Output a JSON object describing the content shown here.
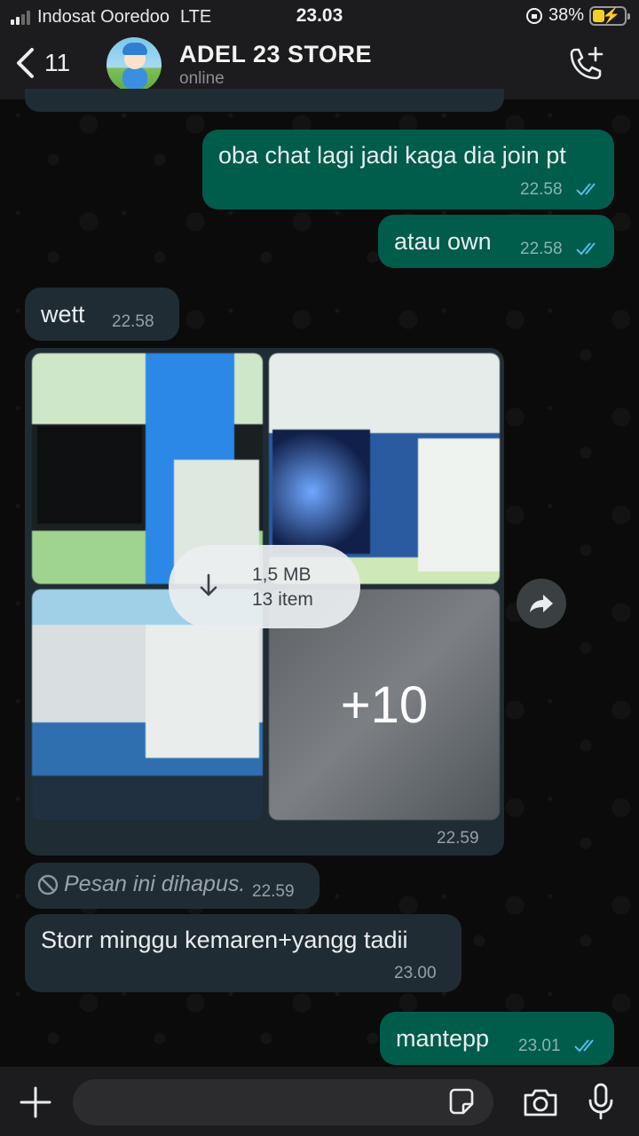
{
  "status_bar": {
    "carrier": "Indosat Ooredoo",
    "network": "LTE",
    "time": "23.03",
    "battery": "38%",
    "battery_level": 0.38
  },
  "header": {
    "back_count": "11",
    "contact_name": "ADEL 23 STORE",
    "contact_status": "online"
  },
  "messages": [
    {
      "direction": "out",
      "text": "oba chat lagi jadi kaga dia join pt",
      "time": "22.58",
      "read": true
    },
    {
      "direction": "out",
      "text": "atau own",
      "time": "22.58",
      "read": true
    },
    {
      "direction": "in",
      "text": "wett",
      "time": "22.58"
    },
    {
      "direction": "in",
      "type": "album",
      "size": "1,5 MB",
      "count": "13 item",
      "more": "+10",
      "time": "22.59"
    },
    {
      "direction": "in",
      "type": "deleted",
      "text": "Pesan ini dihapus.",
      "time": "22.59"
    },
    {
      "direction": "in",
      "text": "Storr minggu kemaren+yangg tadii",
      "time": "23.00"
    },
    {
      "direction": "out",
      "text": "mantepp",
      "time": "23.01",
      "read": true
    }
  ],
  "input": {
    "placeholder": ""
  },
  "colors": {
    "outgoing_bubble": "#005c4b",
    "incoming_bubble": "#202c33",
    "read_ticks": "#53bdeb",
    "bars": "#1c1c1e"
  }
}
